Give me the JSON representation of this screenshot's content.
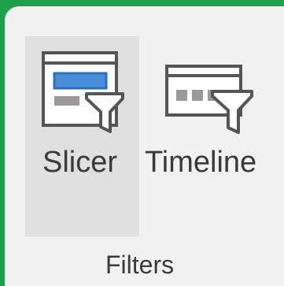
{
  "group": {
    "label": "Filters"
  },
  "buttons": [
    {
      "label": "Slicer",
      "icon": "slicer-icon",
      "state": "hover"
    },
    {
      "label": "Timeline",
      "icon": "timeline-icon"
    }
  ],
  "colors": {
    "window_border": "#1fa04a",
    "ribbon_background": "#f1f1f1",
    "hover_background": "#e0e0e0",
    "icon_accent": "#4a8fdc",
    "icon_stroke": "#555555"
  }
}
